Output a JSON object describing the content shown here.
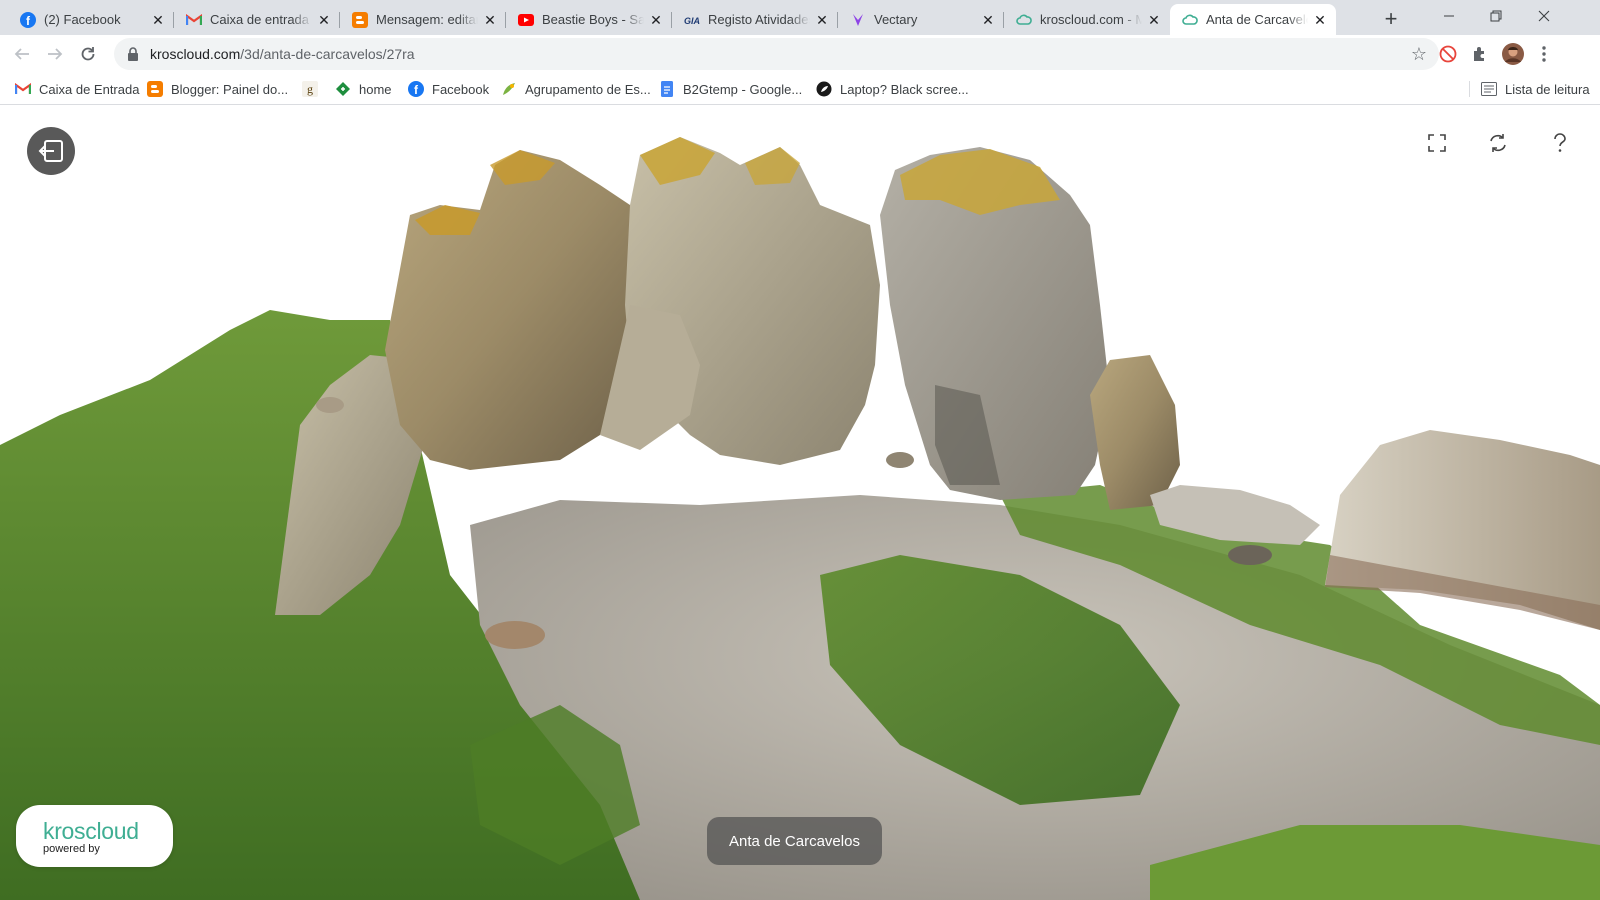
{
  "browser": {
    "tabs": [
      {
        "title": "(2) Facebook",
        "icon": "facebook-icon"
      },
      {
        "title": "Caixa de entrada (",
        "icon": "gmail-icon"
      },
      {
        "title": "Mensagem: editar",
        "icon": "blogger-icon"
      },
      {
        "title": "Beastie Boys - Sab",
        "icon": "youtube-icon"
      },
      {
        "title": "Registo Atividades",
        "icon": "giae-icon"
      },
      {
        "title": "Vectary",
        "icon": "vectary-icon"
      },
      {
        "title": "kroscloud.com - M",
        "icon": "kroscloud-icon"
      },
      {
        "title": "Anta de Carcavelo",
        "icon": "kroscloud-icon",
        "active": true
      }
    ],
    "address": {
      "url_host": "kroscloud.com",
      "url_path": "/3d/anta-de-carcavelos/27ra"
    },
    "bookmarks": [
      {
        "label": "Caixa de Entrada",
        "icon": "gmail-icon"
      },
      {
        "label": "Blogger: Painel do...",
        "icon": "blogger-icon"
      },
      {
        "label": "",
        "icon": "goodreads-icon"
      },
      {
        "label": "home",
        "icon": "home-diamond-icon"
      },
      {
        "label": "Facebook",
        "icon": "facebook-icon"
      },
      {
        "label": "Agrupamento de Es...",
        "icon": "school-icon"
      },
      {
        "label": "B2Gtemp - Google...",
        "icon": "google-docs-icon"
      },
      {
        "label": "Laptop? Black scree...",
        "icon": "site-icon"
      }
    ],
    "reading_list": "Lista de leitura"
  },
  "viewer": {
    "caption": "Anta de Carcavelos",
    "brand": "kroscloud",
    "powered_by": "powered by",
    "accent_color": "#3fae93"
  }
}
